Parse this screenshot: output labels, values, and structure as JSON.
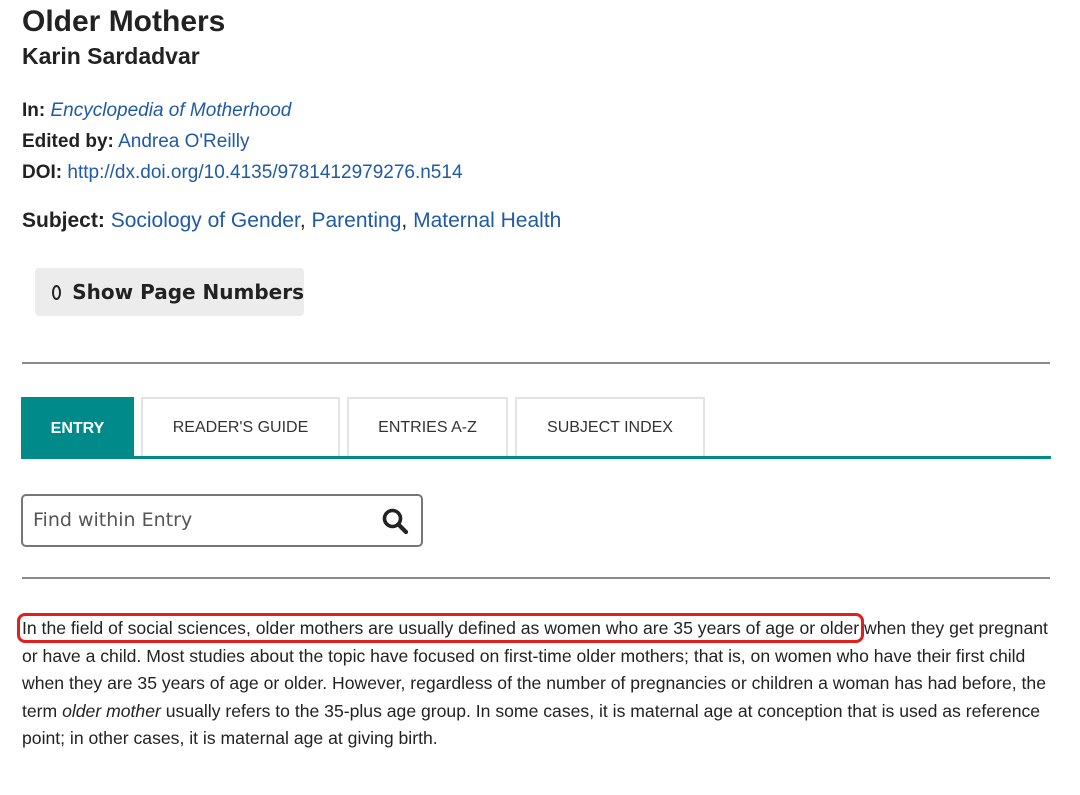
{
  "article": {
    "title": "Older Mothers",
    "author": "Karin Sardadvar"
  },
  "meta": {
    "in_label": "In:",
    "in_value": "Encyclopedia of Motherhood",
    "edited_label": "Edited by:",
    "edited_value": "Andrea O'Reilly",
    "doi_label": "DOI:",
    "doi_value": "http://dx.doi.org/10.4135/9781412979276.n514"
  },
  "subject": {
    "label": "Subject:",
    "items": [
      "Sociology of Gender",
      "Parenting",
      "Maternal Health"
    ],
    "separator": ","
  },
  "page_numbers_button": {
    "label": "Show Page Numbers"
  },
  "tabs": [
    {
      "label": "ENTRY",
      "active": true
    },
    {
      "label": "READER'S GUIDE",
      "active": false
    },
    {
      "label": "ENTRIES A-Z",
      "active": false
    },
    {
      "label": "SUBJECT INDEX",
      "active": false
    }
  ],
  "search": {
    "placeholder": "Find within Entry",
    "value": ""
  },
  "entry_text": {
    "highlighted": "In the field of social sciences, older mothers are usually defined as women who are 35 years of age or older",
    "part1": " when they get pregnant or have a child. Most studies about the topic have focused on first-time older mothers; that is, on women who have their first child when they are 35 years of age or older. However, regardless of the number of pregnancies or children a woman has had before, the term ",
    "term": "older mother",
    "part2": " usually refers to the 35-plus age group. In some cases, it is maternal age at conception that is used as reference point; in other cases, it is maternal age at giving birth."
  },
  "colors": {
    "accent": "#008a8a",
    "link": "#1f5aa6",
    "highlight_box": "#e0201c"
  },
  "icons": {
    "search": "search-icon",
    "toggle": "circle-icon"
  }
}
